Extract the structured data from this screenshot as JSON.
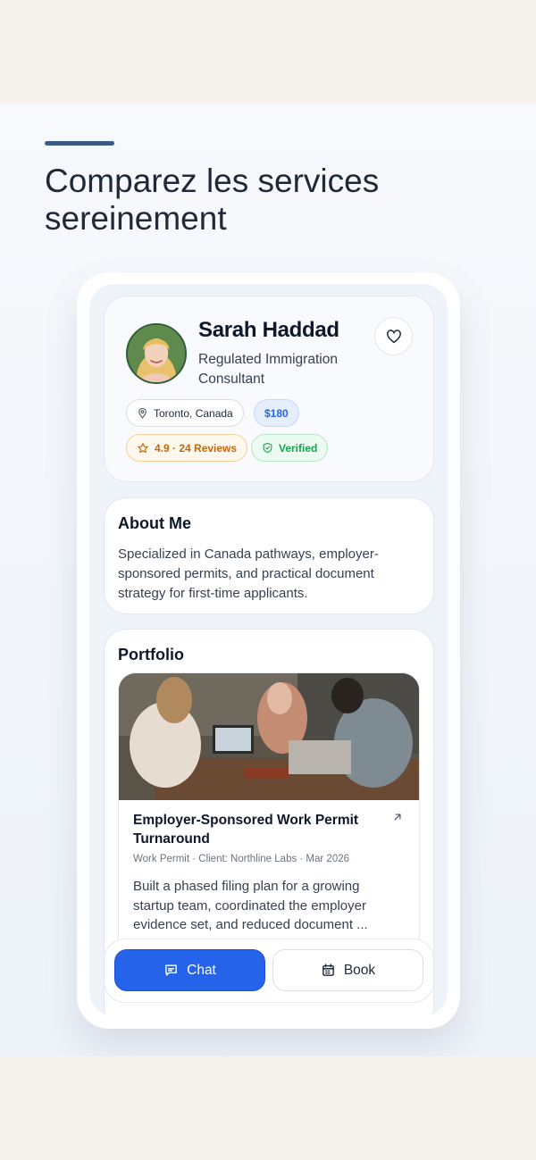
{
  "headline": "Comparez les services sereinement",
  "profile": {
    "name": "Sarah Haddad",
    "title": "Regulated Immigration Consultant",
    "location": "Toronto, Canada",
    "price": "$180",
    "rating": "4.9 · 24 Reviews",
    "verified": "Verified"
  },
  "about": {
    "title": "About Me",
    "text": "Specialized in Canada pathways, employer-sponsored permits, and practical document strategy for first-time applicants."
  },
  "portfolio": {
    "title": "Portfolio",
    "item": {
      "title": "Employer-Sponsored Work Permit Turnaround",
      "meta": "Work Permit · Client: Northline Labs · Mar 2026",
      "description": "Built a phased filing plan for a growing startup team, coordinated the employer evidence set, and reduced document ..."
    }
  },
  "actions": {
    "chat_label": "Chat",
    "book_label": "Book"
  },
  "icons": {
    "favorite": "heart-icon",
    "location": "location-pin-icon",
    "rating": "star-icon",
    "verified": "shield-check-icon",
    "external": "arrow-up-right-icon",
    "chat": "message-icon",
    "book": "calendar-icon"
  },
  "colors": {
    "primary": "#2563eb",
    "accent_bar": "#3b5a85",
    "rating": "#c2680c",
    "verified": "#16a34a"
  }
}
